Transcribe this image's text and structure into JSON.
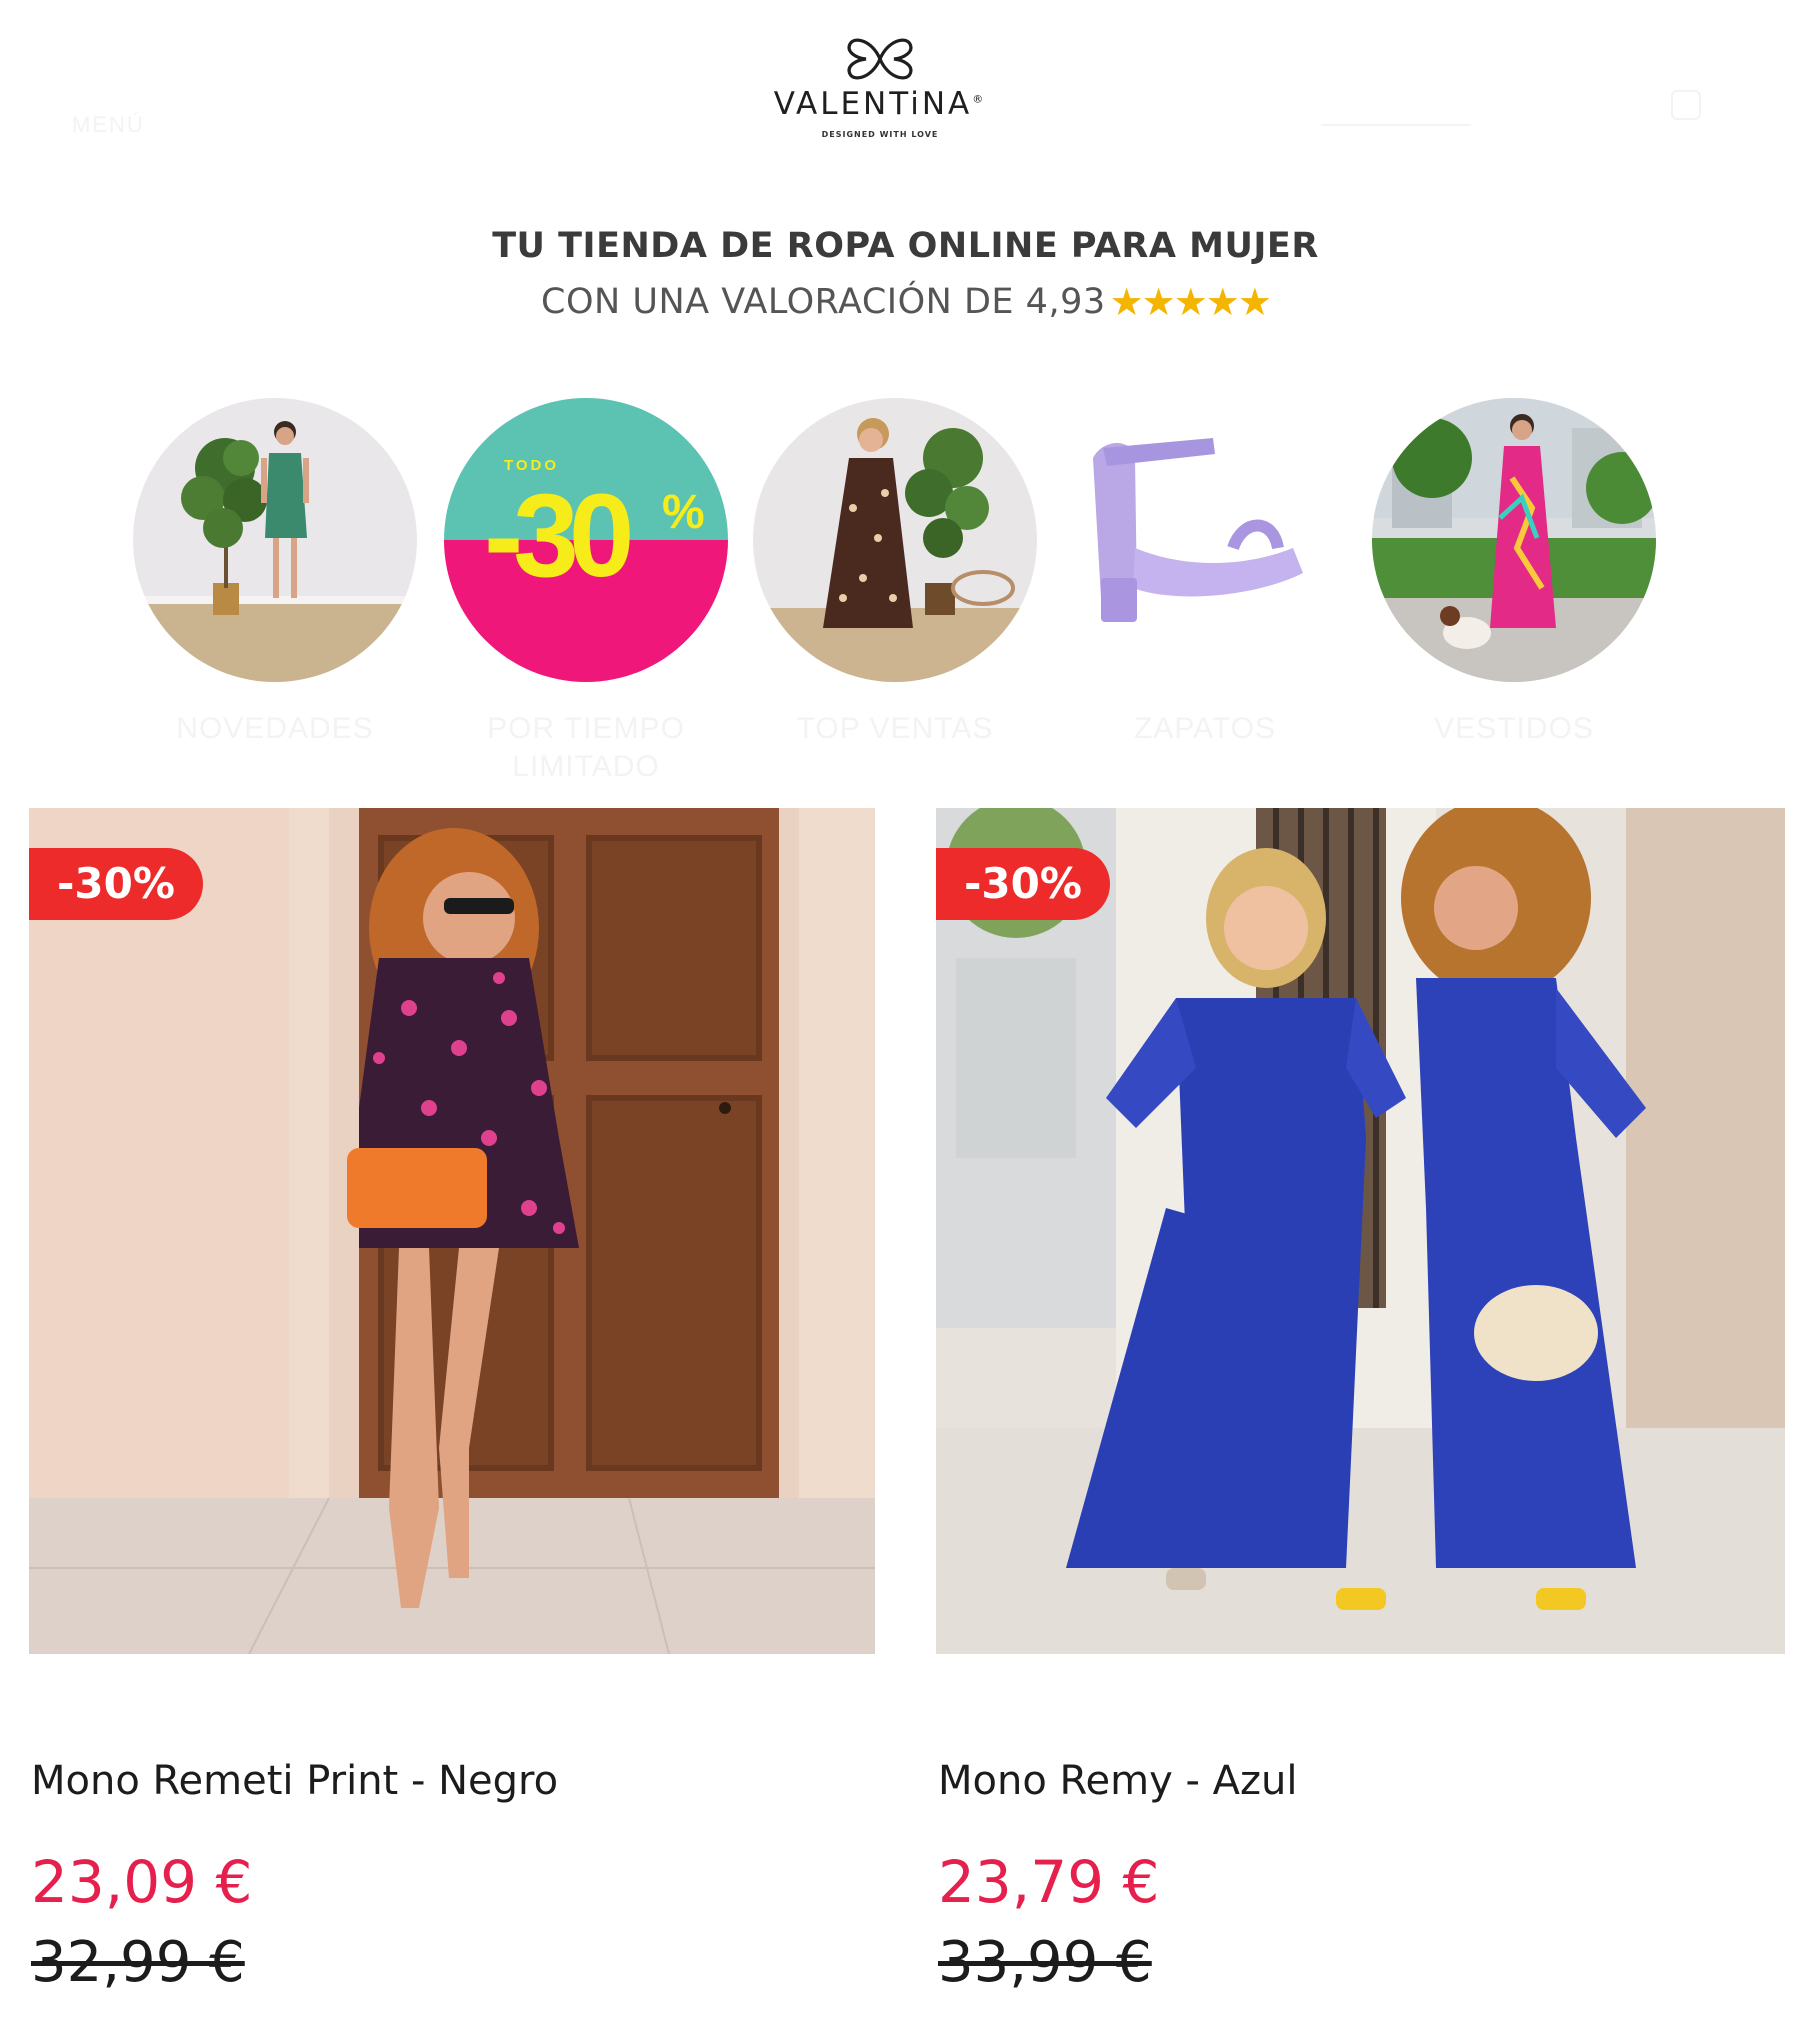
{
  "header": {
    "menu_ghost": "MENÚ",
    "brand": "VALENTiNA",
    "brand_mark": "®",
    "tagline": "DESIGNED WITH LOVE"
  },
  "headline": {
    "line1": "TU TIENDA DE ROPA ONLINE PARA MUJER",
    "line2": "CON UNA VALORACIÓN DE 4,93",
    "rating_stars": "★★★★★",
    "rating_value": 4.93
  },
  "categories": [
    {
      "label": "NOVEDADES",
      "icon": "woman-green-dress-photo"
    },
    {
      "label": "POR TIEMPO LIMITADO",
      "promo_top": "TODO",
      "promo_value": "-30",
      "promo_unit": "%",
      "icon": "sale-30-percent"
    },
    {
      "label": "TOP VENTAS",
      "icon": "woman-polka-dress-photo"
    },
    {
      "label": "ZAPATOS",
      "icon": "lilac-sandal-photo"
    },
    {
      "label": "VESTIDOS",
      "icon": "woman-pink-dress-photo"
    }
  ],
  "products": [
    {
      "name": "Mono Remeti Print - Negro",
      "badge": "-30%",
      "price_now": "23,09 €",
      "price_old": "32,99 €"
    },
    {
      "name": "Mono Remy - Azul",
      "badge": "-30%",
      "price_now": "23,79 €",
      "price_old": "33,99 €"
    }
  ],
  "colors": {
    "sale_red": "#ee2b2b",
    "price_pink": "#e5204c",
    "star_yellow": "#f4b400",
    "promo_teal": "#5cc3b3",
    "promo_magenta": "#f0177a",
    "promo_yellow": "#f5ec1a"
  }
}
